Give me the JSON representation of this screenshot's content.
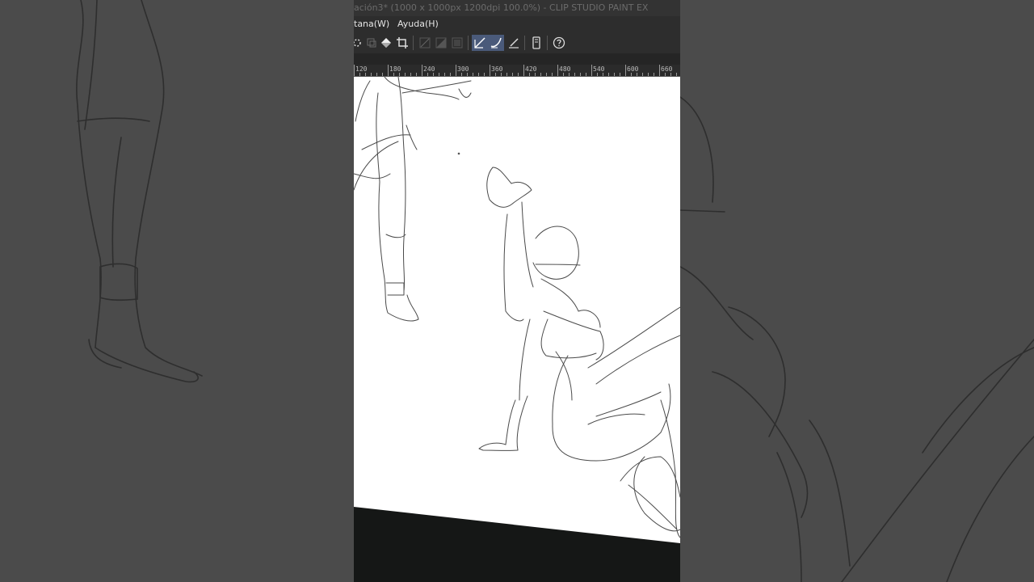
{
  "window": {
    "title": "ación3* (1000 x 1000px 1200dpi 100.0%) - CLIP STUDIO PAINT EX"
  },
  "menu": {
    "items": [
      "tana(W)",
      "Ayuda(H)"
    ]
  },
  "toolbar": {
    "icons": [
      "transform-icon",
      "layer-icon",
      "fill-icon",
      "crop-icon",
      "snap-ruler-icon",
      "snap-special-ruler-icon",
      "snap-grid-icon",
      "stabilizer-icon",
      "curve-icon",
      "pen-pressure-icon",
      "device-icon",
      "help-icon"
    ]
  },
  "ruler": {
    "labels": [
      "120",
      "180",
      "240",
      "300",
      "360",
      "420",
      "480",
      "540",
      "600",
      "660"
    ]
  },
  "colors": {
    "app_bg": "#2a2c2b",
    "canvas_paper": "#ffffff",
    "canvas_bg": "#151716",
    "active_tool": "#4a5a7a",
    "side_bg": "#4b4b4b"
  }
}
